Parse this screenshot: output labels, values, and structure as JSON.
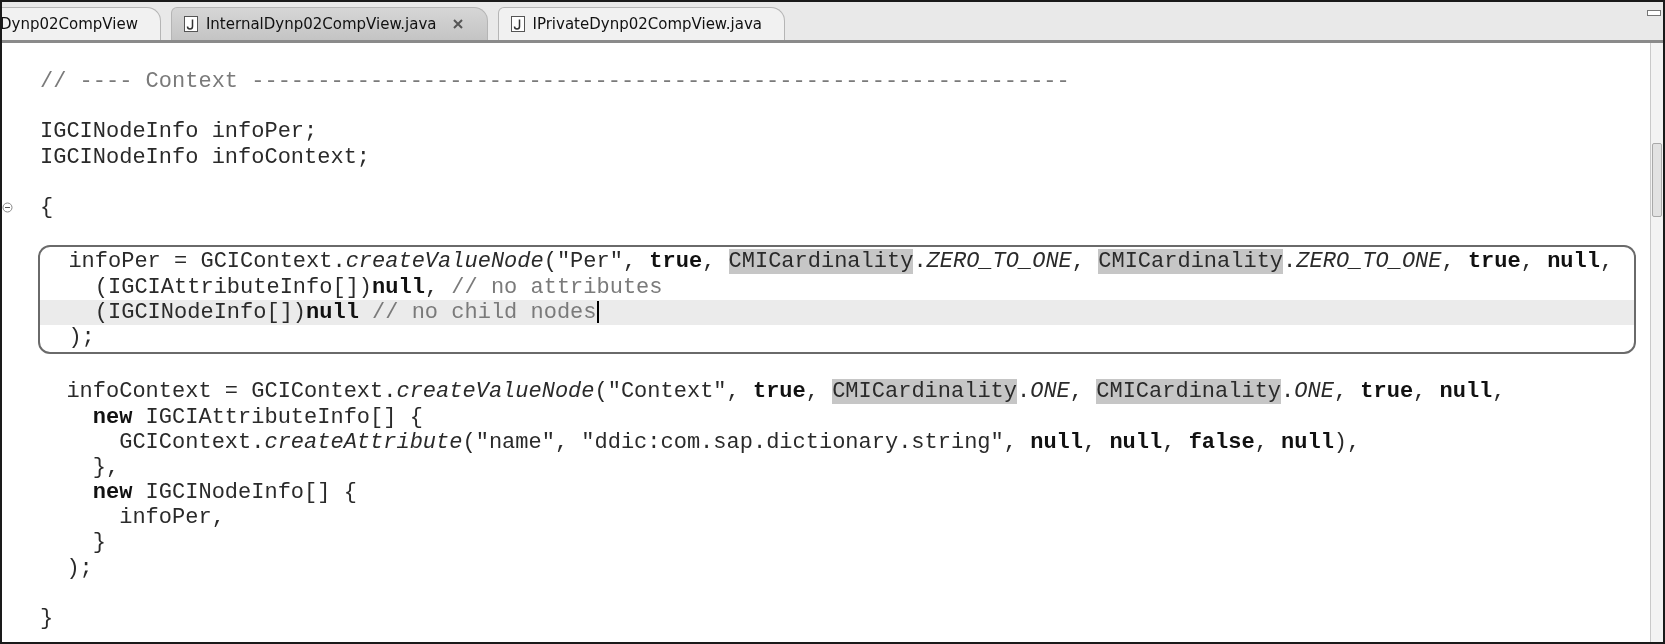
{
  "tabs": [
    {
      "label": "Dynp02CompView",
      "selected": false,
      "file_icon": false
    },
    {
      "label": "InternalDynp02CompView.java",
      "selected": true,
      "file_icon": true
    },
    {
      "label": "IPrivateDynp02CompView.java",
      "selected": false,
      "file_icon": true
    }
  ],
  "editor": {
    "lines": [
      {
        "kind": "code",
        "current": false,
        "tokens": [
          {
            "kind": "comment",
            "text": "// ---- Context --------------------------------------------------------------"
          }
        ]
      },
      {
        "kind": "blank"
      },
      {
        "kind": "code",
        "current": false,
        "tokens": [
          {
            "kind": "plain",
            "text": "IGCINodeInfo infoPer;"
          }
        ]
      },
      {
        "kind": "code",
        "current": false,
        "tokens": [
          {
            "kind": "plain",
            "text": "IGCINodeInfo infoContext;"
          }
        ]
      },
      {
        "kind": "blank"
      },
      {
        "kind": "code",
        "current": false,
        "expanded": true,
        "tokens": [
          {
            "kind": "plain",
            "text": "{"
          }
        ]
      },
      {
        "kind": "blank"
      },
      {
        "kind": "box",
        "lines": [
          {
            "kind": "code",
            "current": false,
            "tokens": [
              {
                "kind": "plain",
                "text": "  infoPer = GCIContext."
              },
              {
                "kind": "static",
                "text": "createValueNode"
              },
              {
                "kind": "plain",
                "text": "(\"Per\", "
              },
              {
                "kind": "keyword",
                "text": "true"
              },
              {
                "kind": "plain",
                "text": ", "
              },
              {
                "kind": "highlight",
                "text": "CMICardinality"
              },
              {
                "kind": "plain",
                "text": "."
              },
              {
                "kind": "static",
                "text": "ZERO_TO_ONE"
              },
              {
                "kind": "plain",
                "text": ", "
              },
              {
                "kind": "highlight",
                "text": "CMICardinality"
              },
              {
                "kind": "plain",
                "text": "."
              },
              {
                "kind": "static",
                "text": "ZERO_TO_ONE"
              },
              {
                "kind": "plain",
                "text": ", "
              },
              {
                "kind": "keyword",
                "text": "true"
              },
              {
                "kind": "plain",
                "text": ", "
              },
              {
                "kind": "keyword",
                "text": "null"
              },
              {
                "kind": "plain",
                "text": ","
              }
            ]
          },
          {
            "kind": "code",
            "current": false,
            "tokens": [
              {
                "kind": "plain",
                "text": "    (IGCIAttributeInfo[])"
              },
              {
                "kind": "keyword",
                "text": "null"
              },
              {
                "kind": "plain",
                "text": ", "
              },
              {
                "kind": "comment",
                "text": "// no attributes"
              }
            ]
          },
          {
            "kind": "code",
            "current": true,
            "tokens": [
              {
                "kind": "plain",
                "text": "    (IGCINodeInfo[])"
              },
              {
                "kind": "keyword",
                "text": "null"
              },
              {
                "kind": "comment",
                "text": " // no child nodes"
              }
            ]
          },
          {
            "kind": "code",
            "current": false,
            "tokens": [
              {
                "kind": "plain",
                "text": "  );"
              }
            ]
          }
        ]
      },
      {
        "kind": "blank"
      },
      {
        "kind": "code",
        "current": false,
        "tokens": [
          {
            "kind": "plain",
            "text": "  infoContext = GCIContext."
          },
          {
            "kind": "static",
            "text": "createValueNode"
          },
          {
            "kind": "plain",
            "text": "(\"Context\", "
          },
          {
            "kind": "keyword",
            "text": "true"
          },
          {
            "kind": "plain",
            "text": ", "
          },
          {
            "kind": "highlight",
            "text": "CMICardinality"
          },
          {
            "kind": "plain",
            "text": "."
          },
          {
            "kind": "static",
            "text": "ONE"
          },
          {
            "kind": "plain",
            "text": ", "
          },
          {
            "kind": "highlight",
            "text": "CMICardinality"
          },
          {
            "kind": "plain",
            "text": "."
          },
          {
            "kind": "static",
            "text": "ONE"
          },
          {
            "kind": "plain",
            "text": ", "
          },
          {
            "kind": "keyword",
            "text": "true"
          },
          {
            "kind": "plain",
            "text": ", "
          },
          {
            "kind": "keyword",
            "text": "null"
          },
          {
            "kind": "plain",
            "text": ","
          }
        ]
      },
      {
        "kind": "code",
        "current": false,
        "tokens": [
          {
            "kind": "keyword",
            "text": "    new"
          },
          {
            "kind": "plain",
            "text": " IGCIAttributeInfo[] {"
          }
        ]
      },
      {
        "kind": "code",
        "current": false,
        "tokens": [
          {
            "kind": "plain",
            "text": "      GCIContext."
          },
          {
            "kind": "static",
            "text": "createAttribute"
          },
          {
            "kind": "plain",
            "text": "(\"name\", \"ddic:com.sap.dictionary.string\", "
          },
          {
            "kind": "keyword",
            "text": "null"
          },
          {
            "kind": "plain",
            "text": ", "
          },
          {
            "kind": "keyword",
            "text": "null"
          },
          {
            "kind": "plain",
            "text": ", "
          },
          {
            "kind": "keyword",
            "text": "false"
          },
          {
            "kind": "plain",
            "text": ", "
          },
          {
            "kind": "keyword",
            "text": "null"
          },
          {
            "kind": "plain",
            "text": "),"
          }
        ]
      },
      {
        "kind": "code",
        "current": false,
        "tokens": [
          {
            "kind": "plain",
            "text": "    },"
          }
        ]
      },
      {
        "kind": "code",
        "current": false,
        "tokens": [
          {
            "kind": "keyword",
            "text": "    new"
          },
          {
            "kind": "plain",
            "text": " IGCINodeInfo[] {"
          }
        ]
      },
      {
        "kind": "code",
        "current": false,
        "tokens": [
          {
            "kind": "plain",
            "text": "      infoPer,"
          }
        ]
      },
      {
        "kind": "code",
        "current": false,
        "tokens": [
          {
            "kind": "plain",
            "text": "    }"
          }
        ]
      },
      {
        "kind": "code",
        "current": false,
        "tokens": [
          {
            "kind": "plain",
            "text": "  );"
          }
        ]
      },
      {
        "kind": "blank"
      },
      {
        "kind": "code",
        "current": false,
        "tokens": [
          {
            "kind": "plain",
            "text": "}"
          }
        ]
      }
    ]
  }
}
